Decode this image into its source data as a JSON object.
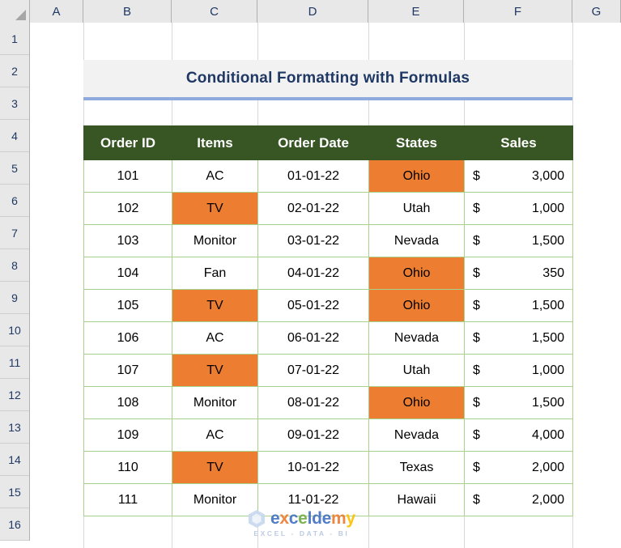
{
  "spreadsheet": {
    "column_headers": [
      "A",
      "B",
      "C",
      "D",
      "E",
      "F",
      "G"
    ],
    "row_headers": [
      "1",
      "2",
      "3",
      "4",
      "5",
      "6",
      "7",
      "8",
      "9",
      "10",
      "11",
      "12",
      "13",
      "14",
      "15",
      "16"
    ],
    "select_all_icon": "select-all-triangle"
  },
  "title": {
    "text": "Conditional Formatting with Formulas"
  },
  "table": {
    "headers": [
      "Order ID",
      "Items",
      "Order Date",
      "States",
      "Sales"
    ],
    "rows": [
      {
        "order_id": "101",
        "item": "AC",
        "item_hl": false,
        "date": "01-01-22",
        "state": "Ohio",
        "state_hl": true,
        "currency": "$",
        "sales": "3,000"
      },
      {
        "order_id": "102",
        "item": "TV",
        "item_hl": true,
        "date": "02-01-22",
        "state": "Utah",
        "state_hl": false,
        "currency": "$",
        "sales": "1,000"
      },
      {
        "order_id": "103",
        "item": "Monitor",
        "item_hl": false,
        "date": "03-01-22",
        "state": "Nevada",
        "state_hl": false,
        "currency": "$",
        "sales": "1,500"
      },
      {
        "order_id": "104",
        "item": "Fan",
        "item_hl": false,
        "date": "04-01-22",
        "state": "Ohio",
        "state_hl": true,
        "currency": "$",
        "sales": "350"
      },
      {
        "order_id": "105",
        "item": "TV",
        "item_hl": true,
        "date": "05-01-22",
        "state": "Ohio",
        "state_hl": true,
        "currency": "$",
        "sales": "1,500"
      },
      {
        "order_id": "106",
        "item": "AC",
        "item_hl": false,
        "date": "06-01-22",
        "state": "Nevada",
        "state_hl": false,
        "currency": "$",
        "sales": "1,500"
      },
      {
        "order_id": "107",
        "item": "TV",
        "item_hl": true,
        "date": "07-01-22",
        "state": "Utah",
        "state_hl": false,
        "currency": "$",
        "sales": "1,000"
      },
      {
        "order_id": "108",
        "item": "Monitor",
        "item_hl": false,
        "date": "08-01-22",
        "state": "Ohio",
        "state_hl": true,
        "currency": "$",
        "sales": "1,500"
      },
      {
        "order_id": "109",
        "item": "AC",
        "item_hl": false,
        "date": "09-01-22",
        "state": "Nevada",
        "state_hl": false,
        "currency": "$",
        "sales": "4,000"
      },
      {
        "order_id": "110",
        "item": "TV",
        "item_hl": true,
        "date": "10-01-22",
        "state": "Texas",
        "state_hl": false,
        "currency": "$",
        "sales": "2,000"
      },
      {
        "order_id": "111",
        "item": "Monitor",
        "item_hl": false,
        "date": "11-01-22",
        "state": "Hawaii",
        "state_hl": false,
        "currency": "$",
        "sales": "2,000"
      }
    ]
  },
  "watermark": {
    "letters": [
      {
        "ch": "e",
        "color": "#4472C4"
      },
      {
        "ch": "x",
        "color": "#ED7D31"
      },
      {
        "ch": "c",
        "color": "#4472C4"
      },
      {
        "ch": "e",
        "color": "#70AD47"
      },
      {
        "ch": "l",
        "color": "#4472C4"
      },
      {
        "ch": "d",
        "color": "#4472C4"
      },
      {
        "ch": "e",
        "color": "#4472C4"
      },
      {
        "ch": "m",
        "color": "#ED7D31"
      },
      {
        "ch": "y",
        "color": "#FFC000"
      }
    ],
    "tagline": "EXCEL - DATA - BI",
    "logo_icon": "hexagon-logo-icon"
  },
  "colors": {
    "highlight_orange": "#ED7D31",
    "header_green": "#375623",
    "cell_border_green": "#A9D18E",
    "title_navy": "#1F3864",
    "title_rule_blue": "#8FAADC",
    "title_bg": "#F2F2F2"
  }
}
